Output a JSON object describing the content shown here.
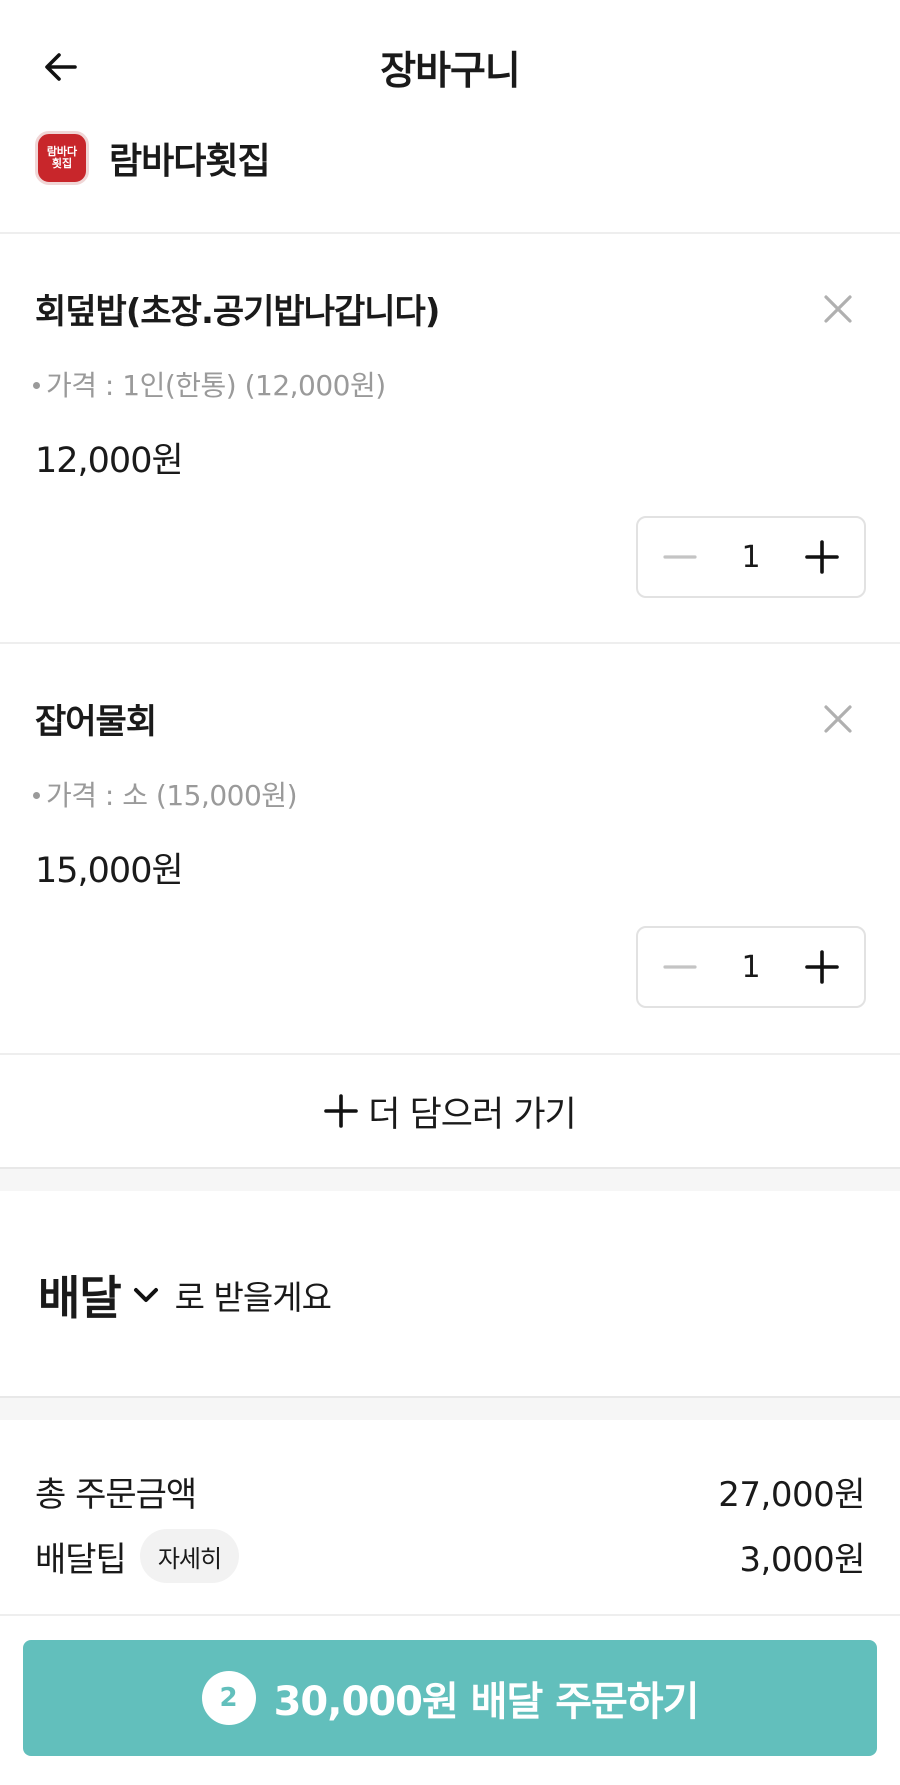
{
  "header": {
    "title": "장바구니",
    "back_icon": "arrow-left-icon"
  },
  "store": {
    "name": "람바다횟집",
    "logo_text": "람바다\n횟집",
    "logo_color": "#c8262b"
  },
  "items": [
    {
      "name": "회덮밥(초장.공기밥나갑니다)",
      "option": "가격 : 1인(한통) (12,000원)",
      "price": "12,000원",
      "quantity": "1"
    },
    {
      "name": "잡어물회",
      "option": "가격 : 소 (15,000원)",
      "price": "15,000원",
      "quantity": "1"
    }
  ],
  "add_more": {
    "label": "더 담으러 가기"
  },
  "delivery": {
    "type": "배달",
    "suffix": "로 받을게요"
  },
  "summary": {
    "total_label": "총 주문금액",
    "total_value": "27,000원",
    "tip_label": "배달팁",
    "tip_detail": "자세히",
    "tip_value": "3,000원"
  },
  "order_button": {
    "count": "2",
    "label": "30,000원 배달 주문하기",
    "color": "#62bfbc"
  }
}
